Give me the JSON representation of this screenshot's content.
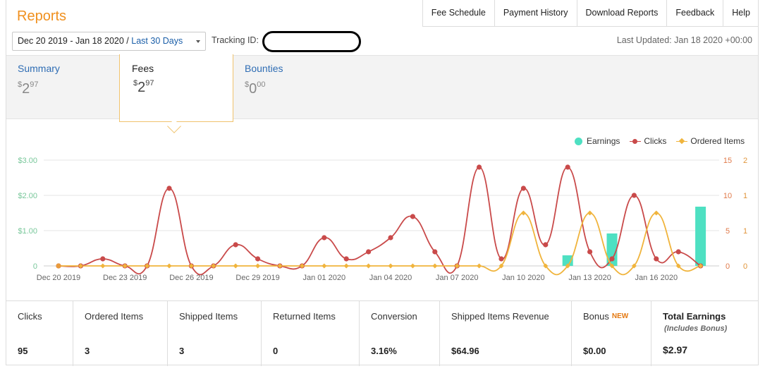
{
  "page": {
    "title": "Reports",
    "top_links": [
      "Fee Schedule",
      "Payment History",
      "Download Reports",
      "Feedback",
      "Help"
    ],
    "date_range": {
      "range": "Dec 20 2019 - Jan 18 2020",
      "separator": "/",
      "preset": "Last 30 Days"
    },
    "tracking_label": "Tracking ID:",
    "last_updated": "Last Updated: Jan 18 2020 +00:00"
  },
  "tabs": [
    {
      "label": "Summary",
      "currency": "$",
      "whole": "2",
      "cents": "97",
      "active": false
    },
    {
      "label": "Fees",
      "currency": "$",
      "whole": "2",
      "cents": "97",
      "active": true
    },
    {
      "label": "Bounties",
      "currency": "$",
      "whole": "0",
      "cents": "00",
      "active": false
    }
  ],
  "colors": {
    "accent": "#f0901e",
    "link": "#2f6db4",
    "earnings": "#4ee0c2",
    "clicks": "#c94a4a",
    "ordered": "#f0b43c"
  },
  "chart_data": {
    "type": "line",
    "x": [
      "Dec 20 2019",
      "Dec 21 2019",
      "Dec 22 2019",
      "Dec 23 2019",
      "Dec 24 2019",
      "Dec 25 2019",
      "Dec 26 2019",
      "Dec 27 2019",
      "Dec 28 2019",
      "Dec 29 2019",
      "Dec 30 2019",
      "Dec 31 2019",
      "Jan 01 2020",
      "Jan 02 2020",
      "Jan 03 2020",
      "Jan 04 2020",
      "Jan 05 2020",
      "Jan 06 2020",
      "Jan 07 2020",
      "Jan 08 2020",
      "Jan 09 2020",
      "Jan 10 2020",
      "Jan 11 2020",
      "Jan 12 2020",
      "Jan 13 2020",
      "Jan 14 2020",
      "Jan 15 2020",
      "Jan 16 2020",
      "Jan 17 2020",
      "Jan 18 2020"
    ],
    "x_tick_labels": [
      "Dec 20 2019",
      "Dec 23 2019",
      "Dec 26 2019",
      "Dec 29 2019",
      "Jan 01 2020",
      "Jan 04 2020",
      "Jan 07 2020",
      "Jan 10 2020",
      "Jan 13 2020",
      "Jan 16 2020"
    ],
    "x_tick_indices": [
      0,
      3,
      6,
      9,
      12,
      15,
      18,
      21,
      24,
      27
    ],
    "series": [
      {
        "name": "Earnings",
        "kind": "bar",
        "axis": "left",
        "color": "#4ee0c2",
        "values": [
          0,
          0,
          0,
          0,
          0,
          0,
          0,
          0,
          0,
          0,
          0,
          0,
          0,
          0,
          0,
          0,
          0,
          0,
          0,
          0,
          0,
          0,
          0,
          0.3,
          0,
          0.92,
          0,
          0,
          0,
          1.68
        ]
      },
      {
        "name": "Clicks",
        "kind": "line",
        "axis": "right1",
        "color": "#c94a4a",
        "values": [
          0,
          0,
          1,
          0,
          0,
          11,
          0,
          0,
          3,
          1,
          0,
          0,
          4,
          1,
          2,
          4,
          7,
          2,
          0,
          14,
          1,
          11,
          3,
          14,
          2,
          1,
          10,
          1,
          2,
          0
        ]
      },
      {
        "name": "Ordered Items",
        "kind": "line",
        "axis": "right2",
        "color": "#f0b43c",
        "values": [
          0,
          0,
          0,
          0,
          0,
          0,
          0,
          0,
          0,
          0,
          0,
          0,
          0,
          0,
          0,
          0,
          0,
          0,
          0,
          0,
          0,
          1,
          0,
          0,
          1,
          0,
          0,
          1,
          0,
          0
        ]
      }
    ],
    "left_axis": {
      "min": 0,
      "max": 3,
      "tick_labels": [
        "0",
        "$1.00",
        "$2.00",
        "$3.00"
      ]
    },
    "right1_axis": {
      "min": 0,
      "max": 15,
      "tick_labels": [
        "0",
        "5",
        "10",
        "15"
      ]
    },
    "right2_axis": {
      "min": 0,
      "max": 2,
      "tick_labels": [
        "0",
        "1",
        "1",
        "2"
      ]
    },
    "legend": {
      "placement": "top-right"
    },
    "grid": true
  },
  "stats": [
    {
      "label": "Clicks",
      "value": "95"
    },
    {
      "label": "Ordered Items",
      "value": "3"
    },
    {
      "label": "Shipped Items",
      "value": "3"
    },
    {
      "label": "Returned Items",
      "value": "0"
    },
    {
      "label": "Conversion",
      "value": "3.16%"
    },
    {
      "label": "Shipped Items Revenue",
      "value": "$64.96"
    },
    {
      "label": "Bonus",
      "badge": "NEW",
      "value": "$0.00"
    },
    {
      "label": "Total Earnings",
      "sub": "(Includes Bonus)",
      "value": "$2.97"
    }
  ]
}
